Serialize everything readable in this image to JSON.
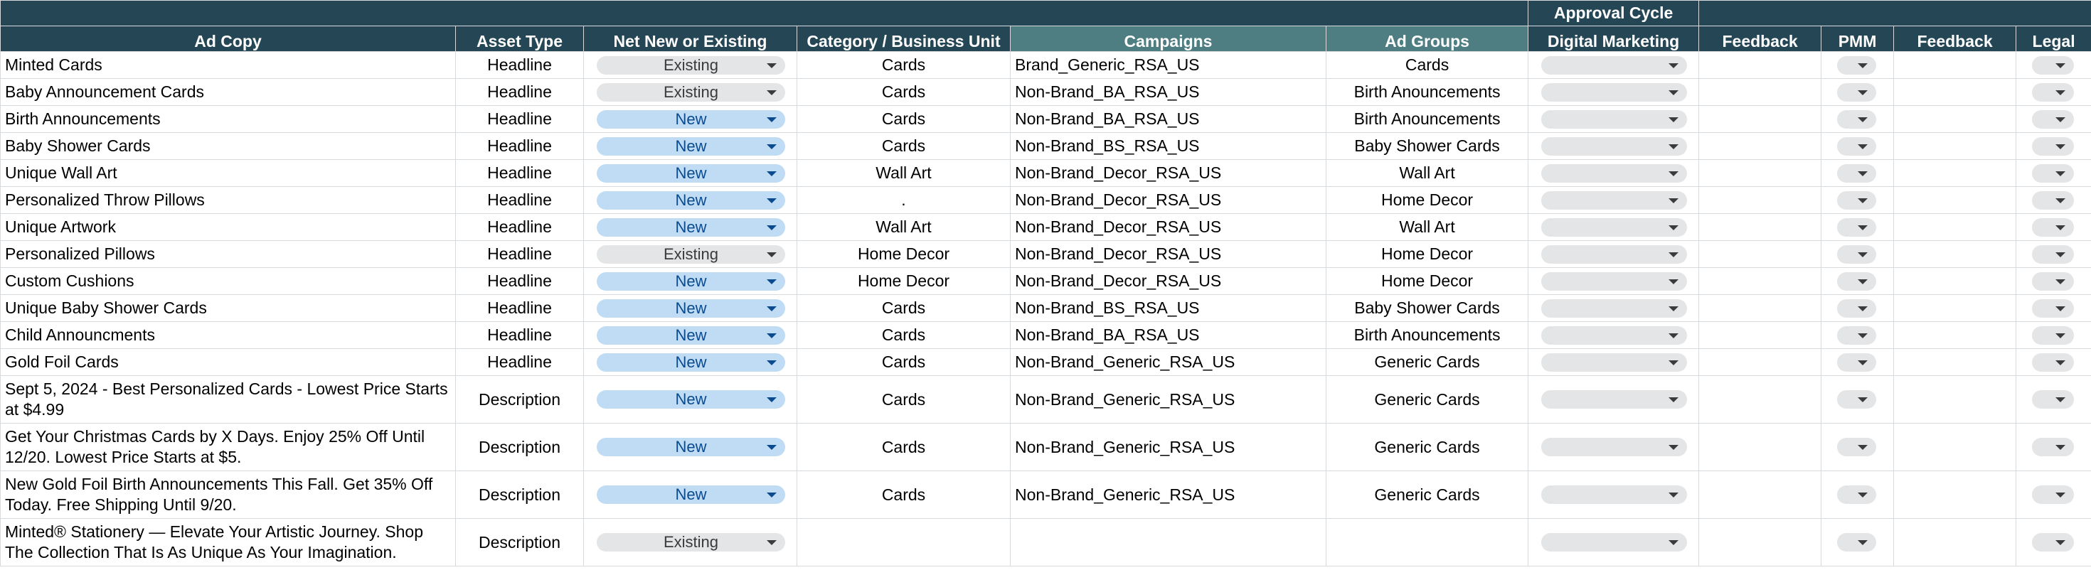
{
  "header": {
    "approval_group": "Approval Cycle",
    "columns": [
      "Ad Copy",
      "Asset Type",
      "Net New or Existing",
      "Category / Business Unit",
      "Campaigns",
      "Ad Groups",
      "Digital Marketing",
      "Feedback",
      "PMM",
      "Feedback",
      "Legal"
    ]
  },
  "rows": [
    {
      "ad_copy": "Minted Cards",
      "asset_type": "Headline",
      "status": "Existing",
      "category": "Cards",
      "campaign": "Brand_Generic_RSA_US",
      "ad_group": "Cards"
    },
    {
      "ad_copy": "Baby Announcement Cards",
      "asset_type": "Headline",
      "status": "Existing",
      "category": "Cards",
      "campaign": "Non-Brand_BA_RSA_US",
      "ad_group": "Birth Anouncements"
    },
    {
      "ad_copy": "Birth Announcements",
      "asset_type": "Headline",
      "status": "New",
      "category": "Cards",
      "campaign": "Non-Brand_BA_RSA_US",
      "ad_group": "Birth Anouncements"
    },
    {
      "ad_copy": "Baby Shower Cards",
      "asset_type": "Headline",
      "status": "New",
      "category": "Cards",
      "campaign": "Non-Brand_BS_RSA_US",
      "ad_group": "Baby Shower Cards"
    },
    {
      "ad_copy": "Unique Wall Art",
      "asset_type": "Headline",
      "status": "New",
      "category": "Wall Art",
      "campaign": "Non-Brand_Decor_RSA_US",
      "ad_group": "Wall Art"
    },
    {
      "ad_copy": "Personalized Throw Pillows",
      "asset_type": "Headline",
      "status": "New",
      "category": ".",
      "campaign": "Non-Brand_Decor_RSA_US",
      "ad_group": "Home Decor"
    },
    {
      "ad_copy": "Unique Artwork",
      "asset_type": "Headline",
      "status": "New",
      "category": "Wall Art",
      "campaign": "Non-Brand_Decor_RSA_US",
      "ad_group": "Wall Art"
    },
    {
      "ad_copy": "Personalized Pillows",
      "asset_type": "Headline",
      "status": "Existing",
      "category": "Home Decor",
      "campaign": "Non-Brand_Decor_RSA_US",
      "ad_group": "Home Decor"
    },
    {
      "ad_copy": "Custom Cushions",
      "asset_type": "Headline",
      "status": "New",
      "category": "Home Decor",
      "campaign": "Non-Brand_Decor_RSA_US",
      "ad_group": "Home Decor"
    },
    {
      "ad_copy": "Unique Baby Shower Cards",
      "asset_type": "Headline",
      "status": "New",
      "category": "Cards",
      "campaign": "Non-Brand_BS_RSA_US",
      "ad_group": "Baby Shower Cards"
    },
    {
      "ad_copy": "Child Announcments",
      "asset_type": "Headline",
      "status": "New",
      "category": "Cards",
      "campaign": "Non-Brand_BA_RSA_US",
      "ad_group": "Birth Anouncements"
    },
    {
      "ad_copy": "Gold Foil Cards",
      "asset_type": "Headline",
      "status": "New",
      "category": "Cards",
      "campaign": "Non-Brand_Generic_RSA_US",
      "ad_group": "Generic Cards"
    },
    {
      "ad_copy": "Sept 5, 2024 - Best Personalized Cards - Lowest Price Starts at $4.99",
      "asset_type": "Description",
      "status": "New",
      "category": "Cards",
      "campaign": "Non-Brand_Generic_RSA_US",
      "ad_group": "Generic Cards"
    },
    {
      "ad_copy": "Get Your Christmas Cards by X Days. Enjoy 25% Off Until 12/20. Lowest Price Starts at $5.",
      "asset_type": "Description",
      "status": "New",
      "category": "Cards",
      "campaign": "Non-Brand_Generic_RSA_US",
      "ad_group": "Generic Cards"
    },
    {
      "ad_copy": "New Gold Foil Birth Announcements This Fall. Get 35% Off Today. Free Shipping Until 9/20.",
      "asset_type": "Description",
      "status": "New",
      "category": "Cards",
      "campaign": "Non-Brand_Generic_RSA_US",
      "ad_group": "Generic Cards"
    },
    {
      "ad_copy": "Minted® Stationery — Elevate Your Artistic Journey. Shop The Collection That Is As Unique As Your Imagination.",
      "asset_type": "Description",
      "status": "Existing",
      "category": "",
      "campaign": "",
      "ad_group": ""
    }
  ],
  "colors": {
    "header_bg": "#254655",
    "header_highlight_bg": "#4e7e82",
    "chip_new_bg": "#bfdcf4",
    "chip_new_text": "#0a4b8f",
    "chip_existing_bg": "#e4e5e7"
  },
  "icons": {
    "dropdown": "dropdown-arrow-icon"
  }
}
